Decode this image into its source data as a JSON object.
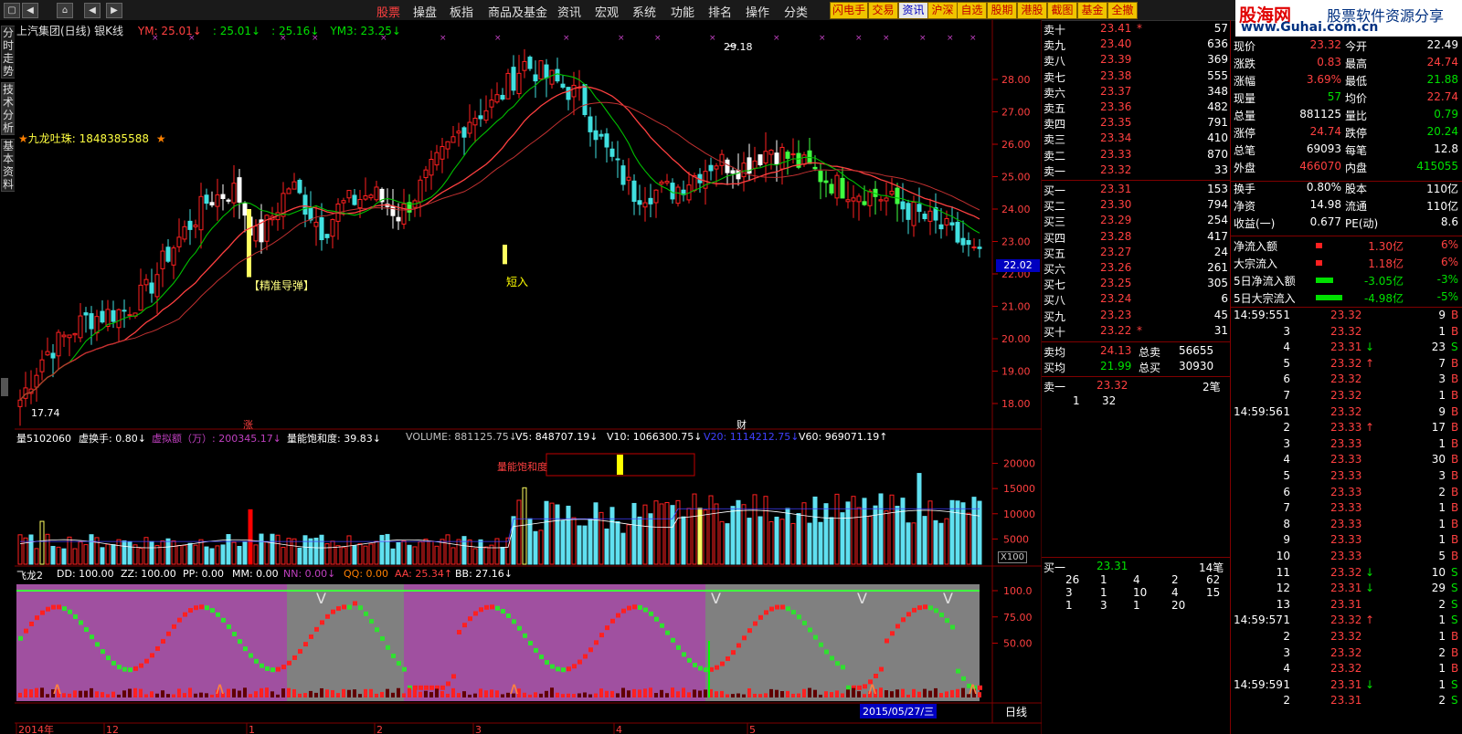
{
  "menubar": {
    "items": [
      {
        "label": "股票",
        "active": true
      },
      {
        "label": "操盘"
      },
      {
        "label": "板指"
      },
      {
        "label": "商品及基金"
      },
      {
        "label": "资讯"
      },
      {
        "label": "宏观"
      },
      {
        "label": "系统"
      },
      {
        "label": "功能"
      },
      {
        "label": "排名"
      },
      {
        "label": "操作"
      },
      {
        "label": "分类"
      }
    ],
    "quick_buttons": [
      "闪电手",
      "交易",
      "资讯",
      "沪深",
      "自选",
      "股期",
      "港股",
      "截图",
      "基金",
      "全撤"
    ]
  },
  "logo": {
    "name": "股海网",
    "slogan": "股票软件资源分享",
    "url": "www.Guhai.com.cn"
  },
  "side_tabs": [
    "分时走势",
    "技术分析",
    "基本资料"
  ],
  "kline": {
    "title": "上汽集团(日线) 银K线",
    "indicators": [
      {
        "label": "YM: 25.01↓",
        "color": "#ff4040"
      },
      {
        "label": ": 25.01↓",
        "color": "#00e000"
      },
      {
        "label": ": 25.16↓",
        "color": "#00e000"
      },
      {
        "label": "YM3: 23.25↓",
        "color": "#00e000"
      }
    ],
    "annotation_star": "九龙吐珠: 1848385588",
    "signal_jdzd": "【精准导弹】",
    "signal_dr": "短入",
    "high_label": "29.18",
    "low_label": "17.74",
    "current_price_tag": "22.02",
    "marker_zhang": "涨",
    "marker_cai": "财",
    "price_axis": [
      "28.00",
      "27.00",
      "26.00",
      "25.00",
      "24.00",
      "23.00",
      "22.00",
      "21.00",
      "20.00",
      "19.00",
      "18.00"
    ]
  },
  "volume": {
    "header": [
      {
        "label": "量5102060",
        "color": "#ffffff"
      },
      {
        "label": "虚换手: 0.80↓",
        "color": "#ffffff"
      },
      {
        "label": "虚拟额（万）: 200345.17↓",
        "color": "#c040c0"
      },
      {
        "label": "量能饱和度: 39.83↓",
        "color": "#ffffff"
      },
      {
        "label": "VOLUME: 881125.75↓",
        "color": "#c0c0c0"
      },
      {
        "label": "V5: 848707.19↓",
        "color": "#ffffff"
      },
      {
        "label": "V10: 1066300.75↓",
        "color": "#ffffff"
      },
      {
        "label": "V20: 1114212.75↓",
        "color": "#4040ff"
      },
      {
        "label": "V60: 969071.19↑",
        "color": "#ffffff"
      }
    ],
    "saturation_label": "量能饱和度",
    "axis": [
      "20000",
      "15000",
      "10000",
      "5000"
    ],
    "unit": "X100"
  },
  "feilong": {
    "header": [
      {
        "label": "飞龙2",
        "color": "#ffffff"
      },
      {
        "label": "DD: 100.00",
        "color": "#ffffff"
      },
      {
        "label": "ZZ: 100.00",
        "color": "#ffffff"
      },
      {
        "label": "PP: 0.00",
        "color": "#ffffff"
      },
      {
        "label": "MM: 0.00",
        "color": "#ffffff"
      },
      {
        "label": "NN: 0.00↓",
        "color": "#c040c0"
      },
      {
        "label": "QQ: 0.00",
        "color": "#ff8000"
      },
      {
        "label": "AA: 25.34↑",
        "color": "#ff4040"
      },
      {
        "label": "BB: 27.16↓",
        "color": "#ffffff"
      }
    ],
    "axis": [
      "100.0",
      "75.00",
      "50.00"
    ]
  },
  "time_axis": {
    "labels": [
      "2014年",
      "12",
      "1",
      "2",
      "3",
      "4",
      "5"
    ],
    "cursor_date": "2015/05/27/三",
    "period": "日线"
  },
  "orderbook": {
    "sells": [
      {
        "label": "卖十",
        "price": "23.41",
        "vol": "57",
        "mark": "*"
      },
      {
        "label": "卖九",
        "price": "23.40",
        "vol": "636",
        "mark": ""
      },
      {
        "label": "卖八",
        "price": "23.39",
        "vol": "369",
        "mark": ""
      },
      {
        "label": "卖七",
        "price": "23.38",
        "vol": "555",
        "mark": ""
      },
      {
        "label": "卖六",
        "price": "23.37",
        "vol": "348",
        "mark": ""
      },
      {
        "label": "卖五",
        "price": "23.36",
        "vol": "482",
        "mark": ""
      },
      {
        "label": "卖四",
        "price": "23.35",
        "vol": "791",
        "mark": ""
      },
      {
        "label": "卖三",
        "price": "23.34",
        "vol": "410",
        "mark": ""
      },
      {
        "label": "卖二",
        "price": "23.33",
        "vol": "870",
        "mark": ""
      },
      {
        "label": "卖一",
        "price": "23.32",
        "vol": "33",
        "mark": ""
      }
    ],
    "buys": [
      {
        "label": "买一",
        "price": "23.31",
        "vol": "153",
        "mark": ""
      },
      {
        "label": "买二",
        "price": "23.30",
        "vol": "794",
        "mark": ""
      },
      {
        "label": "买三",
        "price": "23.29",
        "vol": "254",
        "mark": ""
      },
      {
        "label": "买四",
        "price": "23.28",
        "vol": "417",
        "mark": ""
      },
      {
        "label": "买五",
        "price": "23.27",
        "vol": "24",
        "mark": ""
      },
      {
        "label": "买六",
        "price": "23.26",
        "vol": "261",
        "mark": ""
      },
      {
        "label": "买七",
        "price": "23.25",
        "vol": "305",
        "mark": ""
      },
      {
        "label": "买八",
        "price": "23.24",
        "vol": "6",
        "mark": ""
      },
      {
        "label": "买九",
        "price": "23.23",
        "vol": "45",
        "mark": ""
      },
      {
        "label": "买十",
        "price": "23.22",
        "vol": "31",
        "mark": "*"
      }
    ],
    "sell_avg": {
      "label": "卖均",
      "price": "24.13",
      "tlabel": "总卖",
      "total": "56655"
    },
    "buy_avg": {
      "label": "买均",
      "price": "21.99",
      "tlabel": "总买",
      "total": "30930"
    },
    "sell1_detail": {
      "label": "卖一",
      "price": "23.32",
      "count": "2笔",
      "row": [
        "1",
        "32"
      ]
    },
    "buy1_detail": {
      "label": "买一",
      "price": "23.31",
      "count": "14笔",
      "rows": [
        [
          "26",
          "1",
          "4",
          "2",
          "62"
        ],
        [
          "3",
          "1",
          "10",
          "4",
          "15"
        ],
        [
          "1",
          "3",
          "1",
          "20",
          ""
        ]
      ]
    }
  },
  "stats": [
    {
      "l1": "现价",
      "v1": "23.32",
      "c1": "red",
      "l2": "今开",
      "v2": "22.49",
      "c2": "wht"
    },
    {
      "l1": "涨跌",
      "v1": "0.83",
      "c1": "red",
      "l2": "最高",
      "v2": "24.74",
      "c2": "red"
    },
    {
      "l1": "涨幅",
      "v1": "3.69%",
      "c1": "red",
      "l2": "最低",
      "v2": "21.88",
      "c2": "grn"
    },
    {
      "l1": "现量",
      "v1": "57",
      "c1": "grn",
      "l2": "均价",
      "v2": "22.74",
      "c2": "red"
    },
    {
      "l1": "总量",
      "v1": "881125",
      "c1": "wht",
      "l2": "量比",
      "v2": "0.79",
      "c2": "grn"
    },
    {
      "l1": "涨停",
      "v1": "24.74",
      "c1": "red",
      "l2": "跌停",
      "v2": "20.24",
      "c2": "grn"
    },
    {
      "l1": "总笔",
      "v1": "69093",
      "c1": "wht",
      "l2": "每笔",
      "v2": "12.8",
      "c2": "wht"
    },
    {
      "l1": "外盘",
      "v1": "466070",
      "c1": "red",
      "l2": "内盘",
      "v2": "415055",
      "c2": "grn"
    },
    {
      "l1": "换手",
      "v1": "0.80%",
      "c1": "wht",
      "l2": "股本",
      "v2": "110亿",
      "c2": "wht"
    },
    {
      "l1": "净资",
      "v1": "14.98",
      "c1": "wht",
      "l2": "流通",
      "v2": "110亿",
      "c2": "wht"
    },
    {
      "l1": "收益(一)",
      "v1": "0.677",
      "c1": "wht",
      "l2": "PE(动)",
      "v2": "8.6",
      "c2": "wht"
    }
  ],
  "flows": [
    {
      "label": "净流入额",
      "value": "1.30亿",
      "pct": "6%",
      "color": "red",
      "bar": 0.1
    },
    {
      "label": "大宗流入",
      "value": "1.18亿",
      "pct": "6%",
      "color": "red",
      "bar": 0.1
    },
    {
      "label": "5日净流入额",
      "value": "-3.05亿",
      "pct": "-3%",
      "color": "grn",
      "bar": 0.4
    },
    {
      "label": "5日大宗流入",
      "value": "-4.98亿",
      "pct": "-5%",
      "color": "grn",
      "bar": 0.65
    }
  ],
  "ticks": [
    {
      "time": "14:59:55",
      "n": "1",
      "price": "23.32",
      "arrow": "",
      "vol": "9",
      "side": "B"
    },
    {
      "time": "",
      "n": "3",
      "price": "23.32",
      "arrow": "",
      "vol": "1",
      "side": "B"
    },
    {
      "time": "",
      "n": "4",
      "price": "23.31",
      "arrow": "↓",
      "vol": "23",
      "side": "S"
    },
    {
      "time": "",
      "n": "5",
      "price": "23.32",
      "arrow": "↑",
      "vol": "7",
      "side": "B"
    },
    {
      "time": "",
      "n": "6",
      "price": "23.32",
      "arrow": "",
      "vol": "3",
      "side": "B"
    },
    {
      "time": "",
      "n": "7",
      "price": "23.32",
      "arrow": "",
      "vol": "1",
      "side": "B"
    },
    {
      "time": "14:59:56",
      "n": "1",
      "price": "23.32",
      "arrow": "",
      "vol": "9",
      "side": "B"
    },
    {
      "time": "",
      "n": "2",
      "price": "23.33",
      "arrow": "↑",
      "vol": "17",
      "side": "B"
    },
    {
      "time": "",
      "n": "3",
      "price": "23.33",
      "arrow": "",
      "vol": "1",
      "side": "B"
    },
    {
      "time": "",
      "n": "4",
      "price": "23.33",
      "arrow": "",
      "vol": "30",
      "side": "B"
    },
    {
      "time": "",
      "n": "5",
      "price": "23.33",
      "arrow": "",
      "vol": "3",
      "side": "B"
    },
    {
      "time": "",
      "n": "6",
      "price": "23.33",
      "arrow": "",
      "vol": "2",
      "side": "B"
    },
    {
      "time": "",
      "n": "7",
      "price": "23.33",
      "arrow": "",
      "vol": "1",
      "side": "B"
    },
    {
      "time": "",
      "n": "8",
      "price": "23.33",
      "arrow": "",
      "vol": "1",
      "side": "B"
    },
    {
      "time": "",
      "n": "9",
      "price": "23.33",
      "arrow": "",
      "vol": "1",
      "side": "B"
    },
    {
      "time": "",
      "n": "10",
      "price": "23.33",
      "arrow": "",
      "vol": "5",
      "side": "B"
    },
    {
      "time": "",
      "n": "11",
      "price": "23.32",
      "arrow": "↓",
      "vol": "10",
      "side": "S"
    },
    {
      "time": "",
      "n": "12",
      "price": "23.31",
      "arrow": "↓",
      "vol": "29",
      "side": "S"
    },
    {
      "time": "",
      "n": "13",
      "price": "23.31",
      "arrow": "",
      "vol": "2",
      "side": "S"
    },
    {
      "time": "14:59:57",
      "n": "1",
      "price": "23.32",
      "arrow": "↑",
      "vol": "1",
      "side": "S"
    },
    {
      "time": "",
      "n": "2",
      "price": "23.32",
      "arrow": "",
      "vol": "1",
      "side": "B"
    },
    {
      "time": "",
      "n": "3",
      "price": "23.32",
      "arrow": "",
      "vol": "2",
      "side": "B"
    },
    {
      "time": "",
      "n": "4",
      "price": "23.32",
      "arrow": "",
      "vol": "1",
      "side": "B"
    },
    {
      "time": "14:59:59",
      "n": "1",
      "price": "23.31",
      "arrow": "↓",
      "vol": "1",
      "side": "S"
    },
    {
      "time": "",
      "n": "2",
      "price": "23.31",
      "arrow": "",
      "vol": "2",
      "side": "S"
    }
  ],
  "colors": {
    "up": "#ff2020",
    "down": "#40e0e0",
    "ma1": "#ff4040",
    "ma2": "#00c000",
    "bg": "#000000"
  }
}
